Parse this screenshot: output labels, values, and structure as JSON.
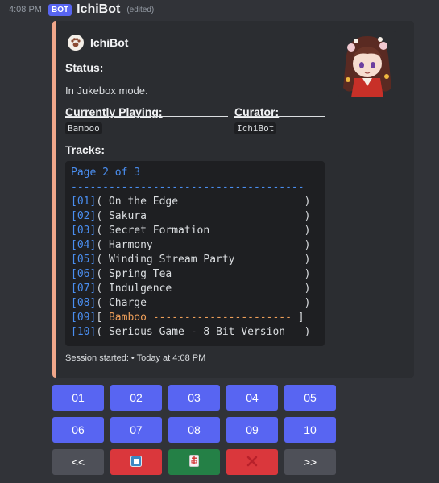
{
  "message": {
    "time": "4:08 PM",
    "bot_tag": "BOT",
    "author": "IchiBot",
    "edited": "(edited)"
  },
  "embed": {
    "author": "IchiBot",
    "accent_color": "#f0a68a",
    "status_label": "Status:",
    "status_value": "In Jukebox mode.",
    "playing_label": "Currently Playing:",
    "playing_value": "Bamboo",
    "curator_label": "Curator:",
    "curator_value": "IchiBot",
    "tracks_label": "Tracks:",
    "page_label": "Page 2 of 3",
    "tracks": [
      {
        "num": "01",
        "title": "On the Edge",
        "current": false
      },
      {
        "num": "02",
        "title": "Sakura",
        "current": false
      },
      {
        "num": "03",
        "title": "Secret Formation",
        "current": false
      },
      {
        "num": "04",
        "title": "Harmony",
        "current": false
      },
      {
        "num": "05",
        "title": "Winding Stream Party",
        "current": false
      },
      {
        "num": "06",
        "title": "Spring Tea",
        "current": false
      },
      {
        "num": "07",
        "title": "Indulgence",
        "current": false
      },
      {
        "num": "08",
        "title": "Charge",
        "current": false
      },
      {
        "num": "09",
        "title": "Bamboo",
        "current": true
      },
      {
        "num": "10",
        "title": "Serious Game - 8 Bit Version",
        "current": false
      }
    ],
    "footer": "Session started: • Today at 4:08 PM"
  },
  "buttons": {
    "row1": [
      "01",
      "02",
      "03",
      "04",
      "05"
    ],
    "row2": [
      "06",
      "07",
      "08",
      "09",
      "10"
    ],
    "prev": "<<",
    "next": ">>",
    "stop_icon": "stop-icon",
    "shuffle_icon": "mahjong-tile-icon",
    "close_icon": "cross-mark-icon"
  }
}
